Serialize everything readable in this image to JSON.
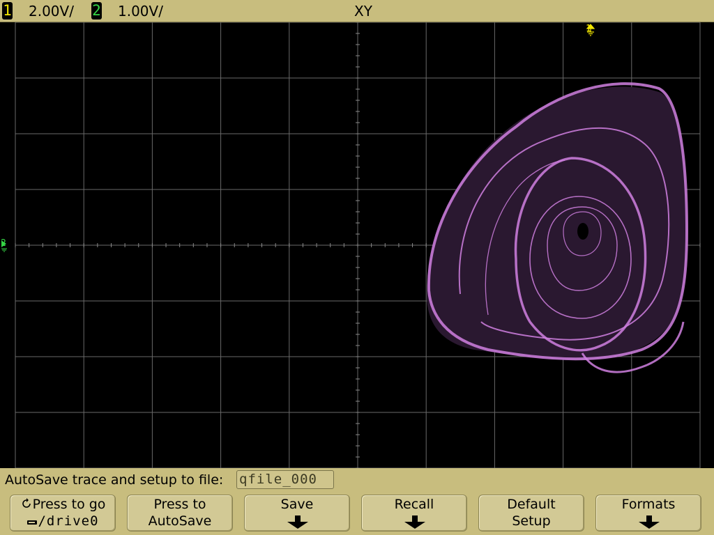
{
  "header": {
    "ch1_number": "1",
    "ch1_scale": "2.00V/",
    "ch2_number": "2",
    "ch2_scale": "1.00V/",
    "mode": "XY"
  },
  "markers": {
    "ch1_ground": "1",
    "ch2_ground": "2"
  },
  "status": {
    "message": "AutoSave trace and setup to file:",
    "filename": "qfile_000"
  },
  "softkeys": [
    {
      "line1": "Press to go",
      "line2": "/drive0",
      "icon": "rotate-icon",
      "sub_icon": "usb-drive-icon"
    },
    {
      "line1": "Press to",
      "line2": "AutoSave"
    },
    {
      "line1": "Save",
      "icon": "down-arrow-icon"
    },
    {
      "line1": "Recall",
      "icon": "down-arrow-icon"
    },
    {
      "line1": "Default",
      "line2": "Setup"
    },
    {
      "line1": "Formats",
      "icon": "down-arrow-icon"
    }
  ],
  "colors": {
    "ch1": "#f2e600",
    "ch2": "#36d646",
    "trace": "#d080e0",
    "grid": "#6e6e6e",
    "panel": "#c8bd7e"
  }
}
